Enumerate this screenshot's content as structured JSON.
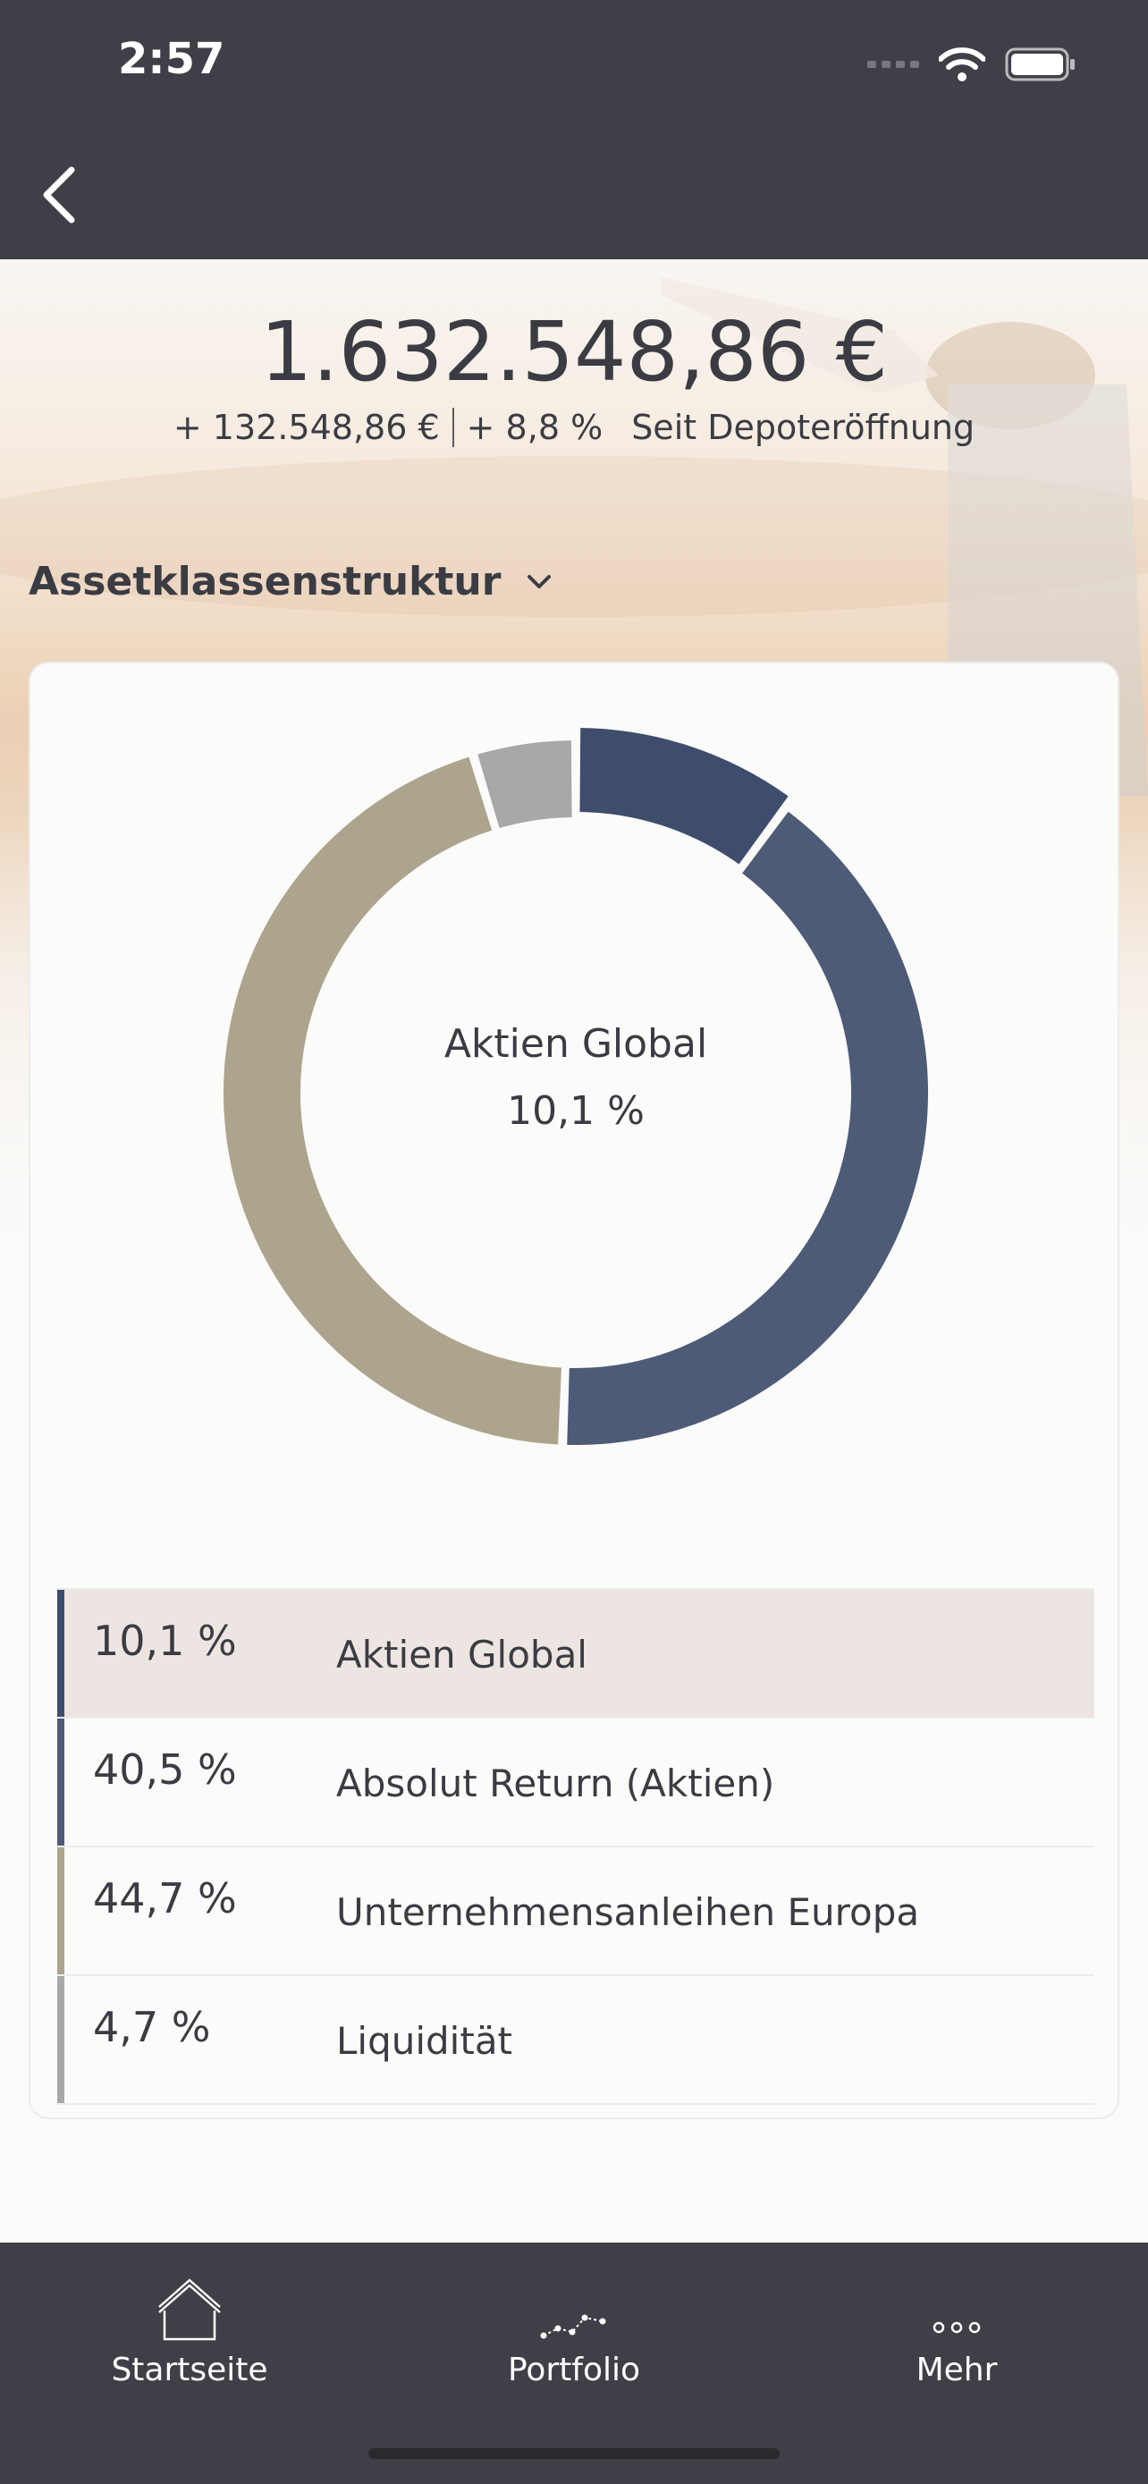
{
  "status_bar": {
    "time": "2:57"
  },
  "colors": {
    "top_bar": "#3f3f47",
    "aktien_global": "#3e4d6b",
    "absolut_return": "#4d5b77",
    "unternehmensanleihen": "#ada48e",
    "liquiditaet": "#a8a8a8",
    "legend_highlight": "#ece5e2"
  },
  "summary": {
    "total": "1.632.548,86 €",
    "change_amount": "+ 132.548,86 €",
    "change_percent": "+ 8,8 %",
    "since_label": "Seit Depoteröffnung"
  },
  "section": {
    "title": "Assetklassenstruktur"
  },
  "chart_data": {
    "type": "pie",
    "variant": "donut",
    "categories": [
      "Aktien Global",
      "Absolut Return (Aktien)",
      "Unternehmensanleihen Europa",
      "Liquidität"
    ],
    "values": [
      10.1,
      40.5,
      44.7,
      4.7
    ],
    "value_labels": [
      "10,1 %",
      "40,5 %",
      "44,7 %",
      "4,7 %"
    ],
    "colors": [
      "#3e4d6b",
      "#4d5b77",
      "#ada48e",
      "#a8a8a8"
    ],
    "selected_index": 0,
    "center_label": "Aktien Global",
    "center_value": "10,1 %"
  },
  "tabs": [
    {
      "label": "Startseite",
      "icon": "house-icon"
    },
    {
      "label": "Portfolio",
      "icon": "line-chart-icon"
    },
    {
      "label": "Mehr",
      "icon": "more-dots-icon"
    }
  ]
}
